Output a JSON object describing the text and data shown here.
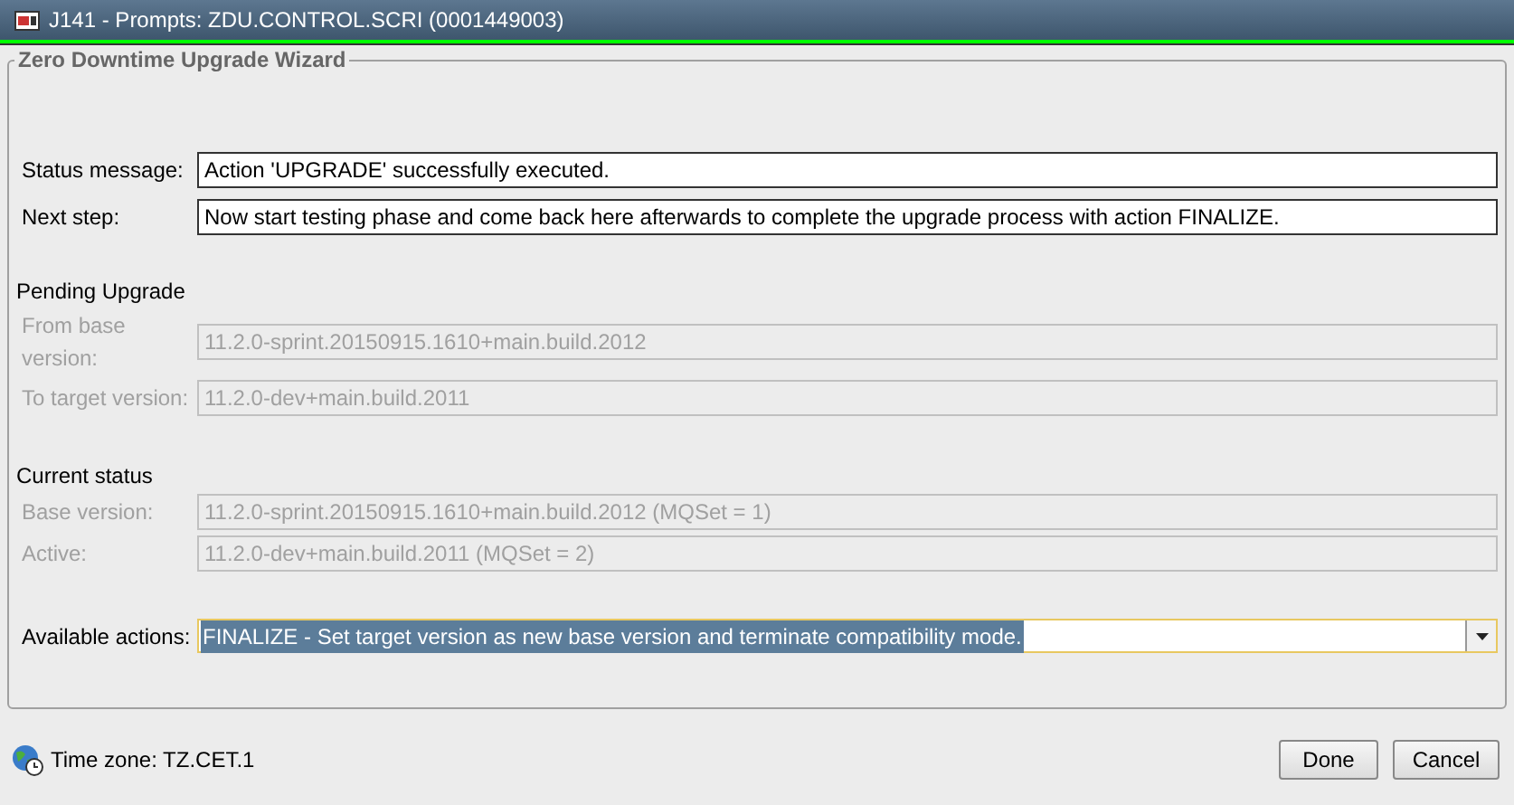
{
  "window": {
    "title": "J141 - Prompts: ZDU.CONTROL.SCRI (0001449003)"
  },
  "group": {
    "title": "Zero Downtime Upgrade Wizard"
  },
  "messages": [
    {
      "label": "Status message:",
      "value": "Action 'UPGRADE' successfully executed.",
      "disabled": false
    },
    {
      "label": "Next step:",
      "value": "Now start testing phase and come back here afterwards to complete the upgrade process with action FINALIZE.",
      "disabled": false
    }
  ],
  "sections": [
    {
      "heading": "Pending Upgrade",
      "fields": [
        {
          "label": "From base version:",
          "value": "11.2.0-sprint.20150915.1610+main.build.2012",
          "disabled": true
        },
        {
          "label": "To target version:",
          "value": "11.2.0-dev+main.build.2011",
          "disabled": true
        }
      ]
    },
    {
      "heading": "Current status",
      "fields": [
        {
          "label": "Base version:",
          "value": "11.2.0-sprint.20150915.1610+main.build.2012 (MQSet = 1)",
          "disabled": true
        },
        {
          "label": "Active:",
          "value": "11.2.0-dev+main.build.2011 (MQSet = 2)",
          "disabled": true
        }
      ]
    }
  ],
  "actions": {
    "label": "Available actions:",
    "value": "FINALIZE - Set target version as new base version and terminate compatibility mode.",
    "selected": true
  },
  "status_bar": {
    "time_zone": "Time zone: TZ.CET.1"
  },
  "buttons": [
    "Done",
    "Cancel"
  ]
}
